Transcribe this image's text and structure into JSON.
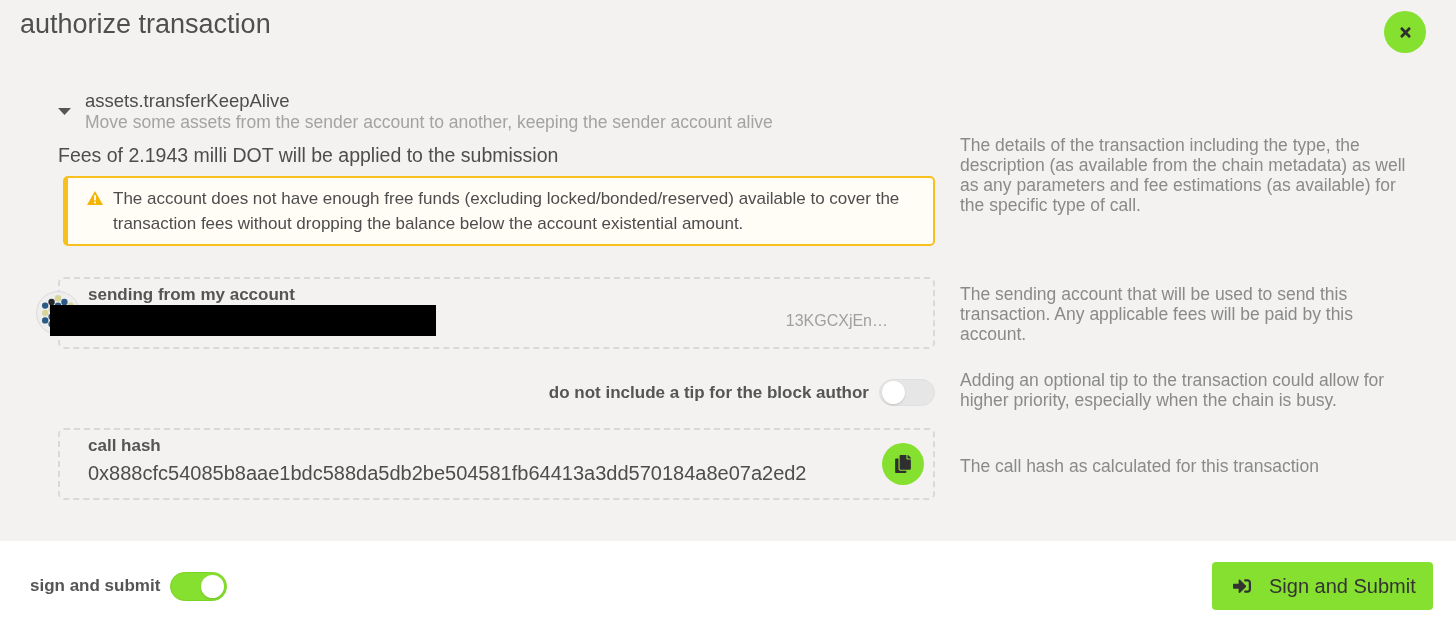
{
  "window": {
    "title": "authorize transaction"
  },
  "call": {
    "name": "assets.transferKeepAlive",
    "description": "Move some assets from the sender account to another, keeping the sender account alive",
    "expanded": false,
    "fees": "Fees of 2.1943 milli DOT will be applied to the submission",
    "warning": "The account does not have enough free funds (excluding locked/bonded/reserved) available to cover the transaction fees without dropping the balance below the account existential amount.",
    "help": "The details of the transaction including the type, the description (as available from the chain metadata) as well as any parameters and fee estimations (as available) for the specific type of call."
  },
  "account": {
    "label": "sending from my account",
    "name_redacted": true,
    "address": "13KGCXjEn…",
    "help": "The sending account that will be used to send this transaction. Any applicable fees will be paid by this account."
  },
  "tip": {
    "label": "do not include a tip for the block author",
    "on": false,
    "help": "Adding an optional tip to the transaction could allow for higher priority, especially when the chain is busy."
  },
  "call_hash": {
    "label": "call hash",
    "value": "0x888cfc54085b8aae1bdc588da5db2be504581fb64413a3dd570184a8e07a2ed2",
    "help": "The call hash as calculated for this transaction"
  },
  "footer": {
    "sign_toggle": {
      "label": "sign and submit",
      "on": true
    },
    "submit_button": {
      "label": "Sign and Submit"
    }
  }
}
